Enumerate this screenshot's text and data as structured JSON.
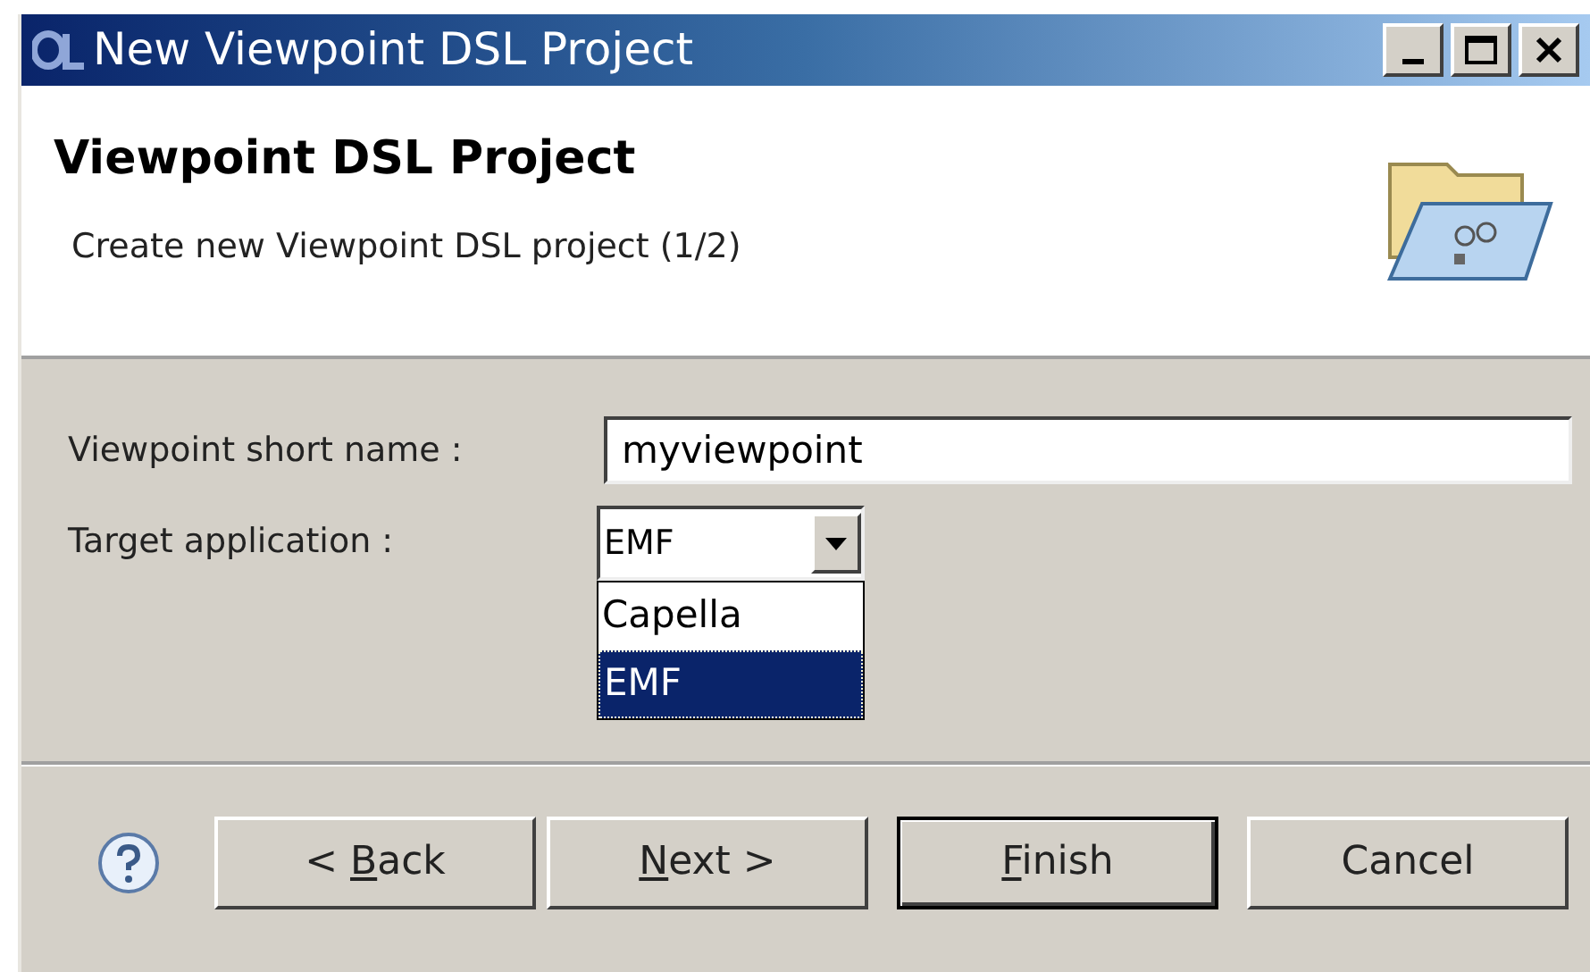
{
  "window": {
    "title": "New Viewpoint DSL Project"
  },
  "header": {
    "title": "Viewpoint DSL Project",
    "description": "Create new Viewpoint DSL project (1/2)"
  },
  "form": {
    "name_label": "Viewpoint short name :",
    "name_value": "myviewpoint",
    "target_label": "Target application :",
    "target_value": "EMF",
    "dropdown_open": true,
    "options": [
      {
        "label": "Capella",
        "selected": false
      },
      {
        "label": "EMF",
        "selected": true
      }
    ]
  },
  "buttons": [
    {
      "label": "< Back",
      "mnemonic_underlined": true,
      "default": false
    },
    {
      "label": "Next >",
      "mnemonic_underlined": true,
      "default": false
    },
    {
      "label": "Finish",
      "mnemonic_underlined": true,
      "default": true
    },
    {
      "label": "Cancel",
      "mnemonic_underlined": false,
      "default": false
    }
  ]
}
